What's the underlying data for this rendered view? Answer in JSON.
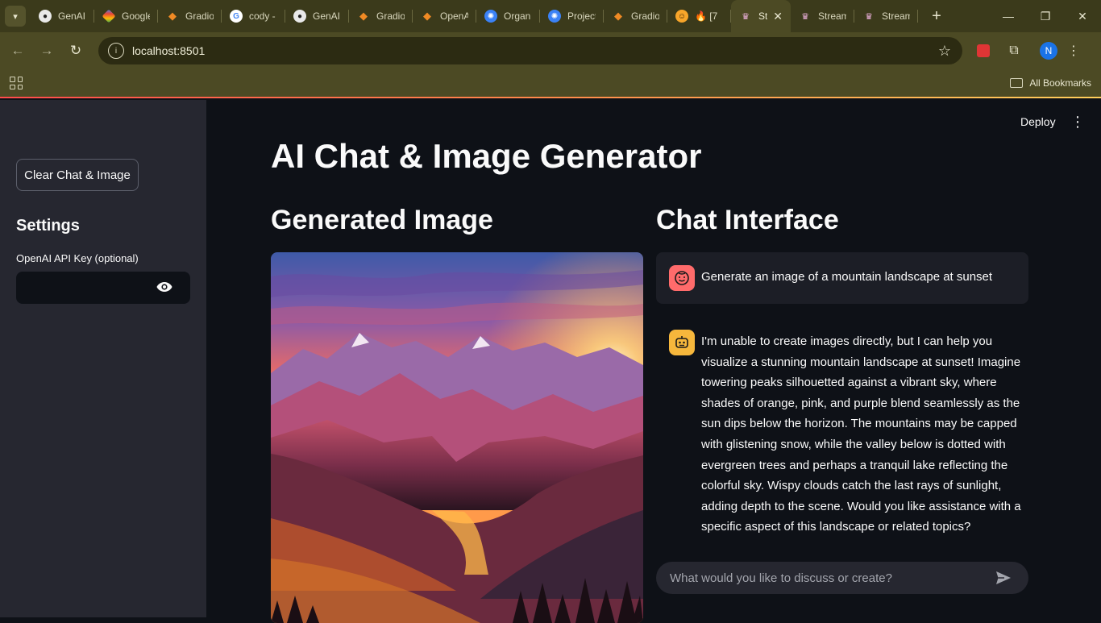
{
  "browser": {
    "tabs": [
      {
        "label": "GenAI",
        "icon": "github-icon"
      },
      {
        "label": "Google",
        "icon": "gemini-icon"
      },
      {
        "label": "Gradio",
        "icon": "gradio-icon"
      },
      {
        "label": "cody -",
        "icon": "google-icon"
      },
      {
        "label": "GenAI",
        "icon": "github-icon"
      },
      {
        "label": "Gradio",
        "icon": "gradio-icon"
      },
      {
        "label": "OpenAI",
        "icon": "gradio-icon"
      },
      {
        "label": "Organ",
        "icon": "openai-icon"
      },
      {
        "label": "Project",
        "icon": "openai-icon"
      },
      {
        "label": "Gradio",
        "icon": "gradio-icon"
      },
      {
        "label": "🔥 [7",
        "icon": "huggingface-icon"
      },
      {
        "label": "St",
        "icon": "streamlit-icon",
        "active": true
      },
      {
        "label": "Stream",
        "icon": "streamlit-icon"
      },
      {
        "label": "Stream",
        "icon": "streamlit-icon"
      }
    ],
    "url": "localhost:8501",
    "profile_initial": "N",
    "bookmarks_label": "All Bookmarks"
  },
  "sidebar": {
    "clear_button": "Clear Chat & Image",
    "settings_heading": "Settings",
    "api_key_label": "OpenAI API Key (optional)",
    "api_key_value": ""
  },
  "header": {
    "deploy_label": "Deploy"
  },
  "main": {
    "title": "AI Chat & Image Generator",
    "image_heading": "Generated Image",
    "chat_heading": "Chat Interface",
    "messages": [
      {
        "role": "user",
        "text": "Generate an image of a mountain landscape at sunset"
      },
      {
        "role": "assistant",
        "text": "I'm unable to create images directly, but I can help you visualize a stunning mountain landscape at sunset! Imagine towering peaks silhouetted against a vibrant sky, where shades of orange, pink, and purple blend seamlessly as the sun dips below the horizon. The mountains may be capped with glistening snow, while the valley below is dotted with evergreen trees and perhaps a tranquil lake reflecting the colorful sky. Wispy clouds catch the last rays of sunlight, adding depth to the scene. Would you like assistance with a specific aspect of this landscape or related topics?"
      }
    ],
    "chat_placeholder": "What would you like to discuss or create?"
  },
  "colors": {
    "primary": "#ff4b4b",
    "background": "#0e1117",
    "sidebar": "#262730",
    "user_avatar": "#ff6b6b",
    "bot_avatar": "#f6b73c"
  }
}
